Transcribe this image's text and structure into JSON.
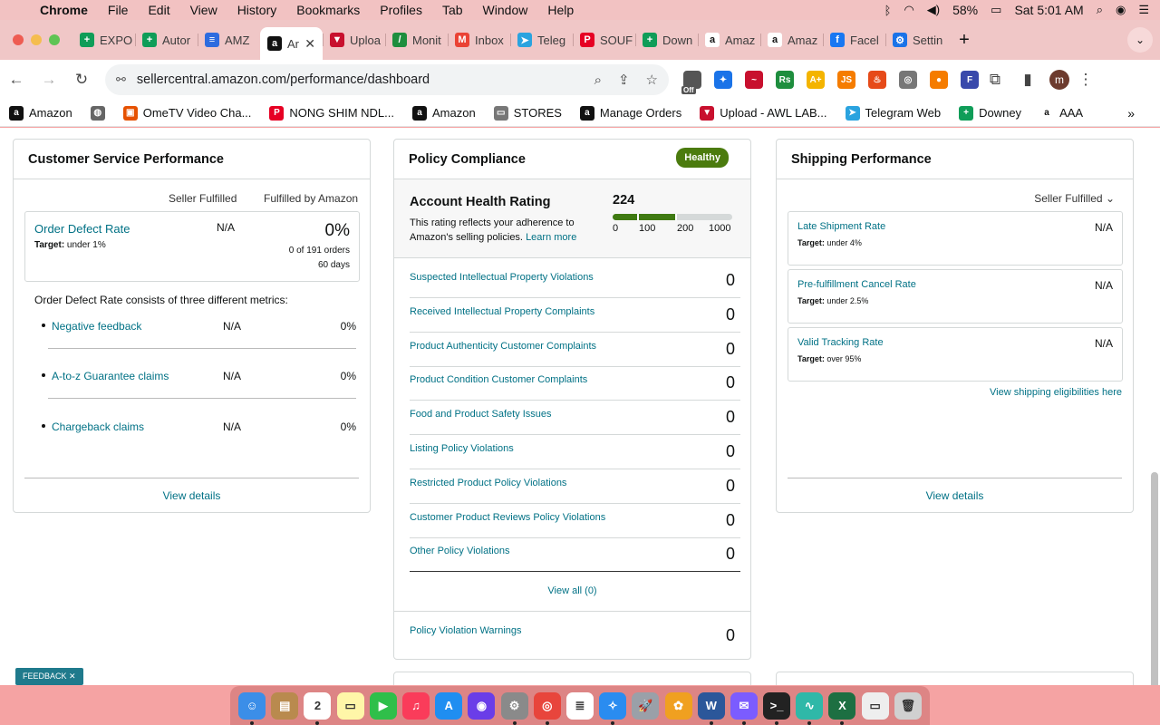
{
  "menubar": {
    "apple": "",
    "app": "Chrome",
    "items": [
      "File",
      "Edit",
      "View",
      "History",
      "Bookmarks",
      "Profiles",
      "Tab",
      "Window",
      "Help"
    ],
    "battery": "58%",
    "clock": "Sat 5:01 AM"
  },
  "tabs": [
    {
      "label": "EXPO",
      "color": "#0f9d58",
      "glyph": "+"
    },
    {
      "label": "Autor",
      "color": "#0f9d58",
      "glyph": "+"
    },
    {
      "label": "AMZ",
      "color": "#2d6cdf",
      "glyph": "≡"
    },
    {
      "label": "Ar",
      "color": "#111111",
      "glyph": "a"
    },
    {
      "label": "Uploa",
      "color": "#c8102e",
      "glyph": "▼"
    },
    {
      "label": "Monit",
      "color": "#1e8e3e",
      "glyph": "/"
    },
    {
      "label": "Inbox",
      "color": "#ea4335",
      "glyph": "M"
    },
    {
      "label": "Teleg",
      "color": "#2aa3df",
      "glyph": "➤"
    },
    {
      "label": "SOUF",
      "color": "#e60023",
      "glyph": "P"
    },
    {
      "label": "Down",
      "color": "#0f9d58",
      "glyph": "+"
    },
    {
      "label": "Amaz",
      "color": "#ffffff",
      "glyph": "a"
    },
    {
      "label": "Amaz",
      "color": "#ffffff",
      "glyph": "a"
    },
    {
      "label": "Facel",
      "color": "#1877f2",
      "glyph": "f"
    },
    {
      "label": "Settin",
      "color": "#1a73e8",
      "glyph": "⚙"
    }
  ],
  "active_tab_index": 3,
  "address": {
    "url": "sellercentral.amazon.com/performance/dashboard"
  },
  "extensions": [
    {
      "glyph": "",
      "color": "#555555"
    },
    {
      "glyph": "✦",
      "color": "#1a73e8"
    },
    {
      "glyph": "~",
      "color": "#c8102e"
    },
    {
      "glyph": "Rs",
      "color": "#1e8e3e"
    },
    {
      "glyph": "A+",
      "color": "#f4b400"
    },
    {
      "glyph": "JS",
      "color": "#f57c00"
    },
    {
      "glyph": "♨",
      "color": "#e64a19"
    },
    {
      "glyph": "◎",
      "color": "#777777"
    },
    {
      "glyph": "●",
      "color": "#f57c00"
    },
    {
      "glyph": "F",
      "color": "#3949ab"
    }
  ],
  "extension_badge": "Off",
  "profile_initial": "m",
  "bookmarks": [
    {
      "label": "Amazon",
      "color": "#111111",
      "glyph": "a"
    },
    {
      "label": "",
      "color": "#666666",
      "glyph": "◍"
    },
    {
      "label": "OmeTV Video Cha...",
      "color": "#e65100",
      "glyph": "▣"
    },
    {
      "label": "NONG SHIM NDL...",
      "color": "#e60023",
      "glyph": "P"
    },
    {
      "label": "Amazon",
      "color": "#111111",
      "glyph": "a"
    },
    {
      "label": "STORES",
      "color": "#777777",
      "glyph": "▭"
    },
    {
      "label": "Manage Orders",
      "color": "#111111",
      "glyph": "a"
    },
    {
      "label": "Upload - AWL LAB...",
      "color": "#c8102e",
      "glyph": "▼"
    },
    {
      "label": "Telegram Web",
      "color": "#2aa3df",
      "glyph": "➤"
    },
    {
      "label": "Downey",
      "color": "#0f9d58",
      "glyph": "+"
    },
    {
      "label": "AAA",
      "color": "#ffffff",
      "glyph": "a"
    }
  ],
  "customer_service": {
    "title": "Customer Service Performance",
    "col_seller": "Seller Fulfilled",
    "col_fba": "Fulfilled by Amazon",
    "odr": {
      "label": "Order Defect Rate",
      "target_prefix": "Target:",
      "target": " under 1%",
      "seller_value": "N/A",
      "fba_value": "0%",
      "orders": "0 of 191 orders",
      "period": "60 days"
    },
    "consists": "Order Defect Rate consists of three different metrics:",
    "metrics": [
      {
        "label": "Negative feedback",
        "seller": "N/A",
        "fba": "0%"
      },
      {
        "label": "A-to-z Guarantee claims",
        "seller": "N/A",
        "fba": "0%"
      },
      {
        "label": "Chargeback claims",
        "seller": "N/A",
        "fba": "0%"
      }
    ],
    "view_details": "View details"
  },
  "policy": {
    "title": "Policy Compliance",
    "badge": "Healthy",
    "ahr": {
      "title": "Account Health Rating",
      "desc": "This rating reflects your adherence to Amazon's selling policies.",
      "learn_more": "Learn more",
      "score": "224",
      "score_value": 224,
      "ticks": [
        "0",
        "100",
        "200",
        "1000"
      ]
    },
    "rows": [
      {
        "label": "Suspected Intellectual Property Violations",
        "count": "0"
      },
      {
        "label": "Received Intellectual Property Complaints",
        "count": "0"
      },
      {
        "label": "Product Authenticity Customer Complaints",
        "count": "0"
      },
      {
        "label": "Product Condition Customer Complaints",
        "count": "0"
      },
      {
        "label": "Food and Product Safety Issues",
        "count": "0"
      },
      {
        "label": "Listing Policy Violations",
        "count": "0"
      },
      {
        "label": "Restricted Product Policy Violations",
        "count": "0"
      },
      {
        "label": "Customer Product Reviews Policy Violations",
        "count": "0"
      },
      {
        "label": "Other Policy Violations",
        "count": "0"
      }
    ],
    "view_all": "View all (0)",
    "warnings": {
      "label": "Policy Violation Warnings",
      "count": "0"
    }
  },
  "shipping": {
    "title": "Shipping Performance",
    "selector": "Seller Fulfilled",
    "metrics": [
      {
        "label": "Late Shipment Rate",
        "target_prefix": "Target:",
        "target": " under 4%",
        "value": "N/A"
      },
      {
        "label": "Pre-fulfillment Cancel Rate",
        "target_prefix": "Target:",
        "target": " under 2.5%",
        "value": "N/A"
      },
      {
        "label": "Valid Tracking Rate",
        "target_prefix": "Target:",
        "target": " over 95%",
        "value": "N/A"
      }
    ],
    "eligibility_link": "View shipping eligibilities here",
    "view_details": "View details"
  },
  "feedback": "FEEDBACK ✕",
  "dock": [
    {
      "name": "finder",
      "color": "#3b8ee8",
      "glyph": "☺",
      "running": true
    },
    {
      "name": "notes-brown",
      "color": "#b98a4e",
      "glyph": "▤",
      "running": false
    },
    {
      "name": "calendar",
      "color": "#ffffff",
      "glyph": "2",
      "running": true
    },
    {
      "name": "notes",
      "color": "#fff6a8",
      "glyph": "▭",
      "running": false
    },
    {
      "name": "facetime",
      "color": "#2fbf4a",
      "glyph": "▶",
      "running": false
    },
    {
      "name": "music",
      "color": "#fa3c5a",
      "glyph": "♫",
      "running": false
    },
    {
      "name": "app-store",
      "color": "#1f8ef1",
      "glyph": "A",
      "running": false
    },
    {
      "name": "siri",
      "color": "#6a3de8",
      "glyph": "◉",
      "running": false
    },
    {
      "name": "system-settings",
      "color": "#8a8a8a",
      "glyph": "⚙",
      "running": true
    },
    {
      "name": "chrome",
      "color": "#e8453c",
      "glyph": "◎",
      "running": true
    },
    {
      "name": "reminders",
      "color": "#ffffff",
      "glyph": "≣",
      "running": false
    },
    {
      "name": "safari",
      "color": "#2a8cf0",
      "glyph": "✧",
      "running": true
    },
    {
      "name": "launchpad",
      "color": "#9aa0a8",
      "glyph": "🚀",
      "running": false
    },
    {
      "name": "photos",
      "color": "#f0a020",
      "glyph": "✿",
      "running": false
    },
    {
      "name": "word",
      "color": "#2b579a",
      "glyph": "W",
      "running": true
    },
    {
      "name": "messenger",
      "color": "#7b5cff",
      "glyph": "✉",
      "running": true
    },
    {
      "name": "terminal",
      "color": "#222222",
      "glyph": ">_",
      "running": true
    },
    {
      "name": "activity-monitor",
      "color": "#2fb8a8",
      "glyph": "∿",
      "running": true
    },
    {
      "name": "excel",
      "color": "#1d6f42",
      "glyph": "X",
      "running": true
    },
    {
      "name": "documents",
      "color": "#eeeeee",
      "glyph": "▭",
      "running": false
    },
    {
      "name": "trash",
      "color": "#d0d0d0",
      "glyph": "🗑",
      "running": false
    }
  ]
}
